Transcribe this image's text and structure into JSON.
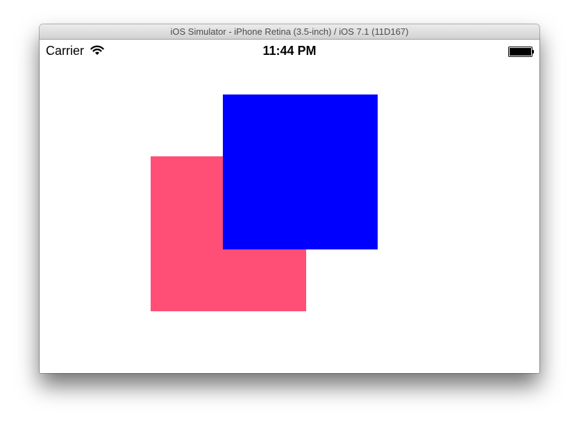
{
  "window": {
    "title": "iOS Simulator - iPhone Retina (3.5-inch) / iOS 7.1 (11D167)"
  },
  "status_bar": {
    "carrier": "Carrier",
    "time": "11:44 PM",
    "wifi_icon": "wifi-icon",
    "battery_icon": "battery-icon",
    "battery_level": 1.0
  },
  "canvas": {
    "squares": [
      {
        "name": "pink-square",
        "color": "#ff4f76"
      },
      {
        "name": "blue-square",
        "color": "#0000ff"
      }
    ]
  }
}
